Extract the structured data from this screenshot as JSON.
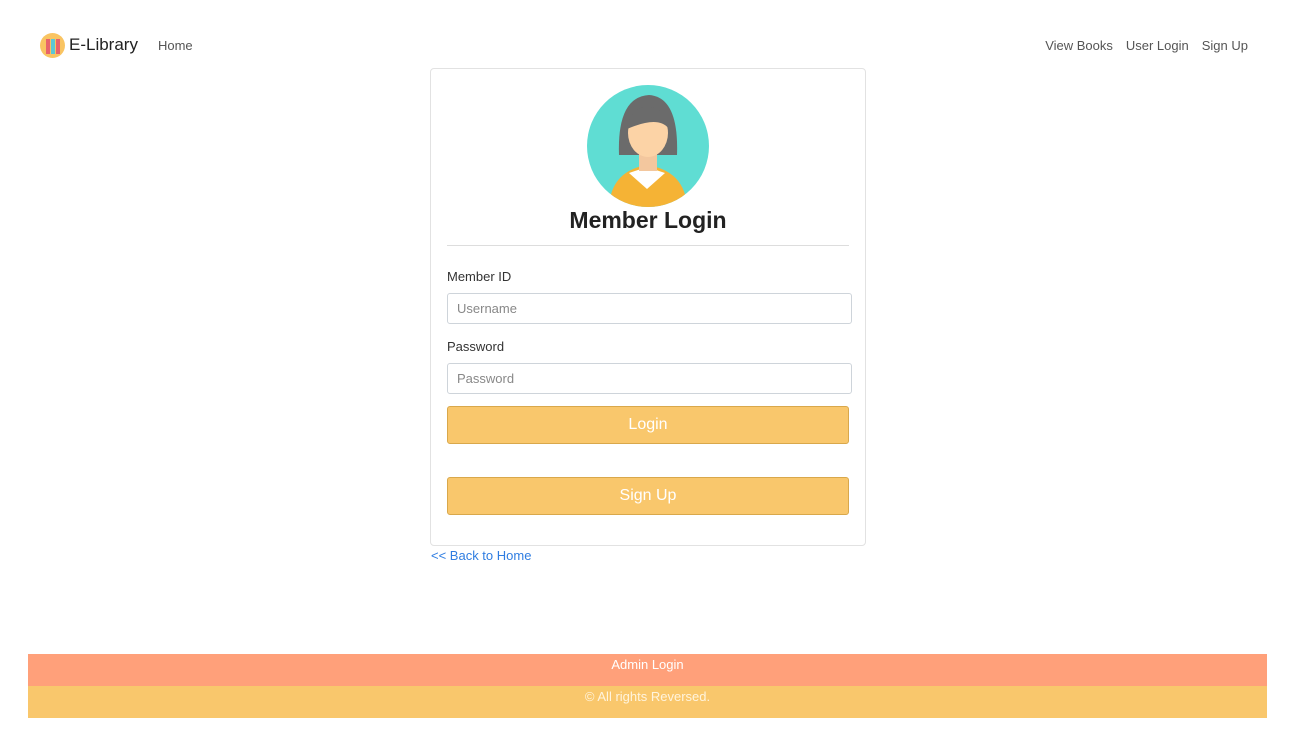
{
  "nav": {
    "brand": "E-Library",
    "home": "Home",
    "links": [
      "View Books",
      "User Login",
      "Sign Up"
    ]
  },
  "card": {
    "title": "Member Login",
    "member_id_label": "Member ID",
    "member_id_placeholder": "Username",
    "password_label": "Password",
    "password_placeholder": "Password",
    "login_label": "Login",
    "signup_label": "Sign Up"
  },
  "back_link": "<< Back to Home",
  "footer": {
    "admin_login": "Admin Login",
    "copyright": "© All rights Reversed."
  }
}
